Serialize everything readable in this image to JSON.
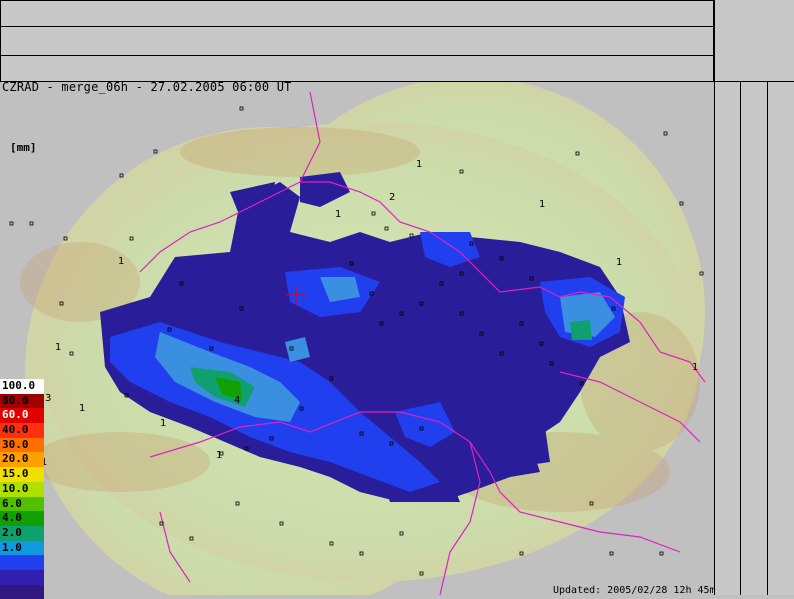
{
  "product": {
    "title": "CZRAD - merge_06h - 27.02.2005 06:00 UT",
    "unit": "[mm]",
    "updated": "Updated: 2005/02/28 12h 45m"
  },
  "legend": {
    "items": [
      {
        "label": "100.0",
        "color": "#ffffff",
        "text": "#000000"
      },
      {
        "label": "80.0",
        "color": "#a00000",
        "text": "#000000"
      },
      {
        "label": "60.0",
        "color": "#e00000",
        "text": "#ffffff"
      },
      {
        "label": "40.0",
        "color": "#ff3010",
        "text": "#000000"
      },
      {
        "label": "30.0",
        "color": "#ff7000",
        "text": "#000000"
      },
      {
        "label": "20.0",
        "color": "#ffa000",
        "text": "#000000"
      },
      {
        "label": "15.0",
        "color": "#f0e000",
        "text": "#000000"
      },
      {
        "label": "10.0",
        "color": "#b0e000",
        "text": "#000000"
      },
      {
        "label": "6.0",
        "color": "#50c000",
        "text": "#000000"
      },
      {
        "label": "4.0",
        "color": "#10a000",
        "text": "#000000"
      },
      {
        "label": "2.0",
        "color": "#10a070",
        "text": "#000000"
      },
      {
        "label": "1.0",
        "color": "#1098e0",
        "text": "#000000"
      },
      {
        "label": "",
        "color": "#2040f0",
        "text": "#000000"
      },
      {
        "label": "",
        "color": "#3020b0",
        "text": "#000000"
      },
      {
        "label": "",
        "color": "#301880",
        "text": "#000000"
      }
    ]
  },
  "station_labels": [
    "1",
    "1",
    "2",
    "1",
    "1",
    "1",
    "1",
    "1",
    "1",
    "4",
    "1",
    "1",
    "3",
    "1"
  ],
  "colors": {
    "background": "#c0c0c0",
    "map_terrain": "#cfe0b0",
    "precip_low": "#2a1d9a",
    "precip_mid": "#2040f0",
    "precip_1mm": "#3a8fe0",
    "precip_2mm": "#10a070",
    "border_line": "#e020c0"
  }
}
